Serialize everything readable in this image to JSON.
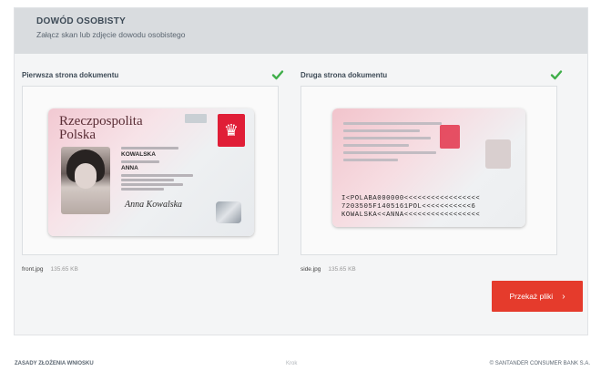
{
  "header": {
    "title": "DOWÓD OSOBISTY",
    "subtitle": "Załącz skan lub zdjęcie dowodu osobistego"
  },
  "documents": [
    {
      "label": "Pierwsza strona dokumentu",
      "file_name": "front.jpg",
      "file_size": "135.65 KB",
      "status_icon": "check-icon"
    },
    {
      "label": "Druga strona dokumentu",
      "file_name": "side.jpg",
      "file_size": "135.65 KB",
      "status_icon": "check-icon"
    }
  ],
  "front_card": {
    "country_line1": "Rzeczpospolita",
    "country_line2": "Polska",
    "surname": "KOWALSKA",
    "given_name": "ANNA",
    "signature": "Anna Kowalska"
  },
  "back_card": {
    "mrz_line1": "I<POLABA000000<<<<<<<<<<<<<<<<<",
    "mrz_line2": "7203505F1405161POL<<<<<<<<<<<6",
    "mrz_line3": "KOWALSKA<<ANNA<<<<<<<<<<<<<<<<<"
  },
  "actions": {
    "submit_label": "Przekaż pliki"
  },
  "footer": {
    "left": "ZASADY ZŁOŻENIA WNIOSKU",
    "center": "Krok",
    "right": "© SANTANDER CONSUMER BANK S.A."
  },
  "colors": {
    "accent": "#e53b2c",
    "check": "#3fae49",
    "header_bg": "#d9dcdf"
  }
}
